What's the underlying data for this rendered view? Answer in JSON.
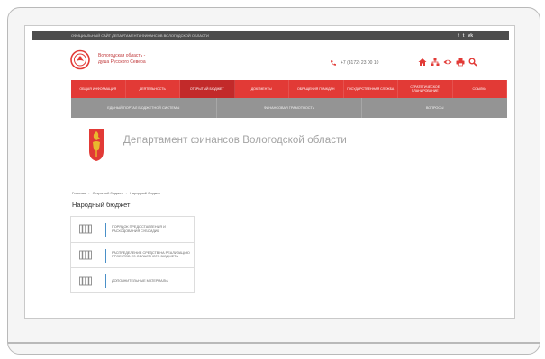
{
  "topbar": {
    "text": "ОФИЦИАЛЬНЫЙ САЙТ ДЕПАРТАМЕНТА ФИНАНСОВ ВОЛОГОДСКОЙ ОБЛАСТИ",
    "social": [
      "f",
      "t",
      "vk"
    ]
  },
  "logo": {
    "line1": "Вологодская область -",
    "line2": "душа Русского Севера"
  },
  "header": {
    "phone": "+7 (8172) 23 00 10",
    "tool_icons": [
      "home-icon",
      "sitemap-icon",
      "eye-icon",
      "print-icon",
      "search-icon"
    ]
  },
  "nav": {
    "items": [
      "ОБЩАЯ ИНФОРМАЦИЯ",
      "ДЕЯТЕЛЬНОСТЬ",
      "ОТКРЫТЫЙ БЮДЖЕТ",
      "ДОКУМЕНТЫ",
      "ОБРАЩЕНИЯ ГРАЖДАН",
      "ГОСУДАРСТВЕННАЯ СЛУЖБА",
      "СТРАТЕГИЧЕСКОЕ ПЛАНИРОВАНИЕ",
      "ССЫЛКИ"
    ],
    "active_index": 2
  },
  "subnav": {
    "items": [
      "ЕДИНЫЙ ПОРТАЛ БЮДЖЕТНОЙ СИСТЕМЫ",
      "ФИНАНСОВАЯ ГРАМОТНОСТЬ",
      "ВОПРОСЫ"
    ]
  },
  "department": {
    "title": "Департамент финансов Вологодской области"
  },
  "breadcrumb": {
    "items": [
      "Главная",
      "Открытый бюджет",
      "Народный бюджет"
    ],
    "separator": "›"
  },
  "page": {
    "title": "Народный бюджет"
  },
  "documents": {
    "items": [
      "ПОРЯДОК ПРЕДОСТАВЛЕНИЯ И РАСХОДОВАНИЯ СУБСИДИЙ",
      "РАСПРЕДЕЛЕНИЕ СРЕДСТВ НА РЕАЛИЗАЦИЮ ПРОЕКТОВ ИЗ ОБЛАСТНОГО БЮДЖЕТА",
      "ДОПОЛНИТЕЛЬНЫЕ МАТЕРИАЛЫ"
    ]
  },
  "colors": {
    "nav_red": "#e23a36",
    "nav_active": "#c22a2a",
    "subnav_gray": "#949494",
    "topbar": "#4d4d4d",
    "accent_blue": "#4a90c8"
  }
}
